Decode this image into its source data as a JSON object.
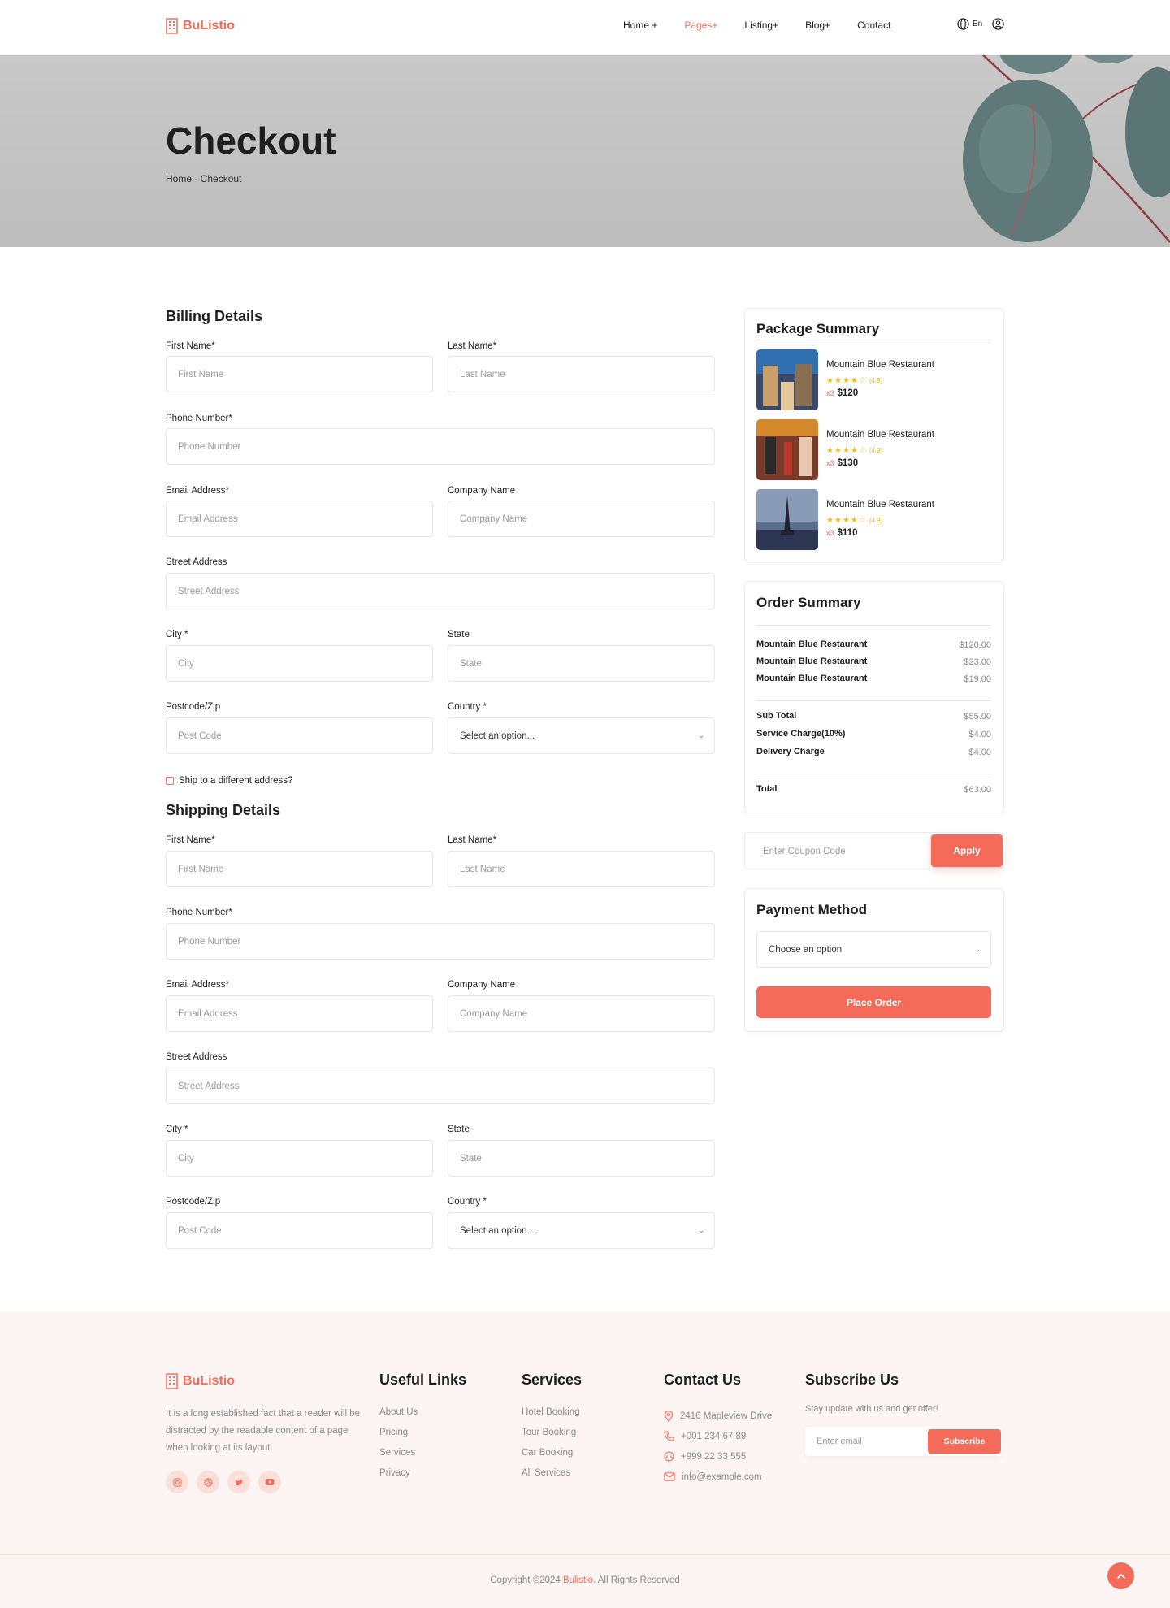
{
  "nav": {
    "brand": "BuListio",
    "links": [
      "Home +",
      "Pages+",
      "Listing+",
      "Blog+",
      "Contact"
    ],
    "active_index": 1,
    "language": "En"
  },
  "hero": {
    "title": "Checkout",
    "breadcrumb": "Home - Checkout"
  },
  "billing": {
    "title": "Billing Details",
    "first_name_label": "First Name*",
    "first_name_placeholder": "First Name",
    "last_name_label": "Last Name*",
    "last_name_placeholder": "Last Name",
    "phone_label": "Phone Number*",
    "phone_placeholder": "Phone Number",
    "email_label": "Email Address*",
    "email_placeholder": "Email Address",
    "company_label": "Company Name",
    "company_placeholder": "Company Name",
    "street_label": "Street Address",
    "street_placeholder": "Street Address",
    "city_label": "City *",
    "city_placeholder": "City",
    "state_label": "State",
    "state_placeholder": "State",
    "postcode_label": "Postcode/Zip",
    "postcode_placeholder": "Post Code",
    "country_label": "Country *",
    "country_value": "Select an option..."
  },
  "ship_checkbox_label": "Ship to a different address?",
  "shipping": {
    "title": "Shipping Details",
    "first_name_label": "First Name*",
    "first_name_placeholder": "First Name",
    "last_name_label": "Last Name*",
    "last_name_placeholder": "Last Name",
    "phone_label": "Phone Number*",
    "phone_placeholder": "Phone Number",
    "email_label": "Email Address*",
    "email_placeholder": "Email Address",
    "company_label": "Company Name",
    "company_placeholder": "Company Name",
    "street_label": "Street Address",
    "street_placeholder": "Street Address",
    "city_label": "City *",
    "city_placeholder": "City",
    "state_label": "State",
    "state_placeholder": "State",
    "postcode_label": "Postcode/Zip",
    "postcode_placeholder": "Post Code",
    "country_label": "Country *",
    "country_value": "Select an option..."
  },
  "package_summary": {
    "title": "Package Summary",
    "items": [
      {
        "name": "Mountain Blue Restaurant",
        "stars": 4,
        "rating": "(4.9)",
        "qty": "x3",
        "price": "$120"
      },
      {
        "name": "Mountain Blue Restaurant",
        "stars": 4,
        "rating": "(4.9)",
        "qty": "x3",
        "price": "$130"
      },
      {
        "name": "Mountain Blue Restaurant",
        "stars": 4,
        "rating": "(4.9)",
        "qty": "x3",
        "price": "$110"
      }
    ]
  },
  "order_summary": {
    "title": "Order Summary",
    "items": [
      {
        "name": "Mountain Blue Restaurant",
        "price": "$120.00"
      },
      {
        "name": "Mountain Blue Restaurant",
        "price": "$23.00"
      },
      {
        "name": "Mountain Blue Restaurant",
        "price": "$19.00"
      }
    ],
    "sub_total_label": "Sub Total",
    "sub_total": "$55.00",
    "service_label": "Service Charge(10%)",
    "service": "$4.00",
    "delivery_label": "Delivery Charge",
    "delivery": "$4.00",
    "total_label": "Total",
    "total": "$63.00"
  },
  "coupon": {
    "placeholder": "Enter Coupon Code",
    "button": "Apply"
  },
  "payment": {
    "title": "Payment Method",
    "select_value": "Choose an option",
    "button": "Place Order"
  },
  "footer": {
    "brand": "BuListio",
    "about": "It is a long established fact that a reader will be distracted by the readable content of a page when looking at its layout.",
    "useful_title": "Useful Links",
    "useful_links": [
      "About Us",
      "Pricing",
      "Services",
      "Privacy"
    ],
    "services_title": "Services",
    "services_links": [
      "Hotel Booking",
      "Tour Booking",
      "Car Booking",
      "All Services"
    ],
    "contact_title": "Contact Us",
    "contact": {
      "address": "2416 Mapleview Drive",
      "phone1": "+001 234 67 89",
      "phone2": "+999 22 33 555",
      "email": "info@example.com"
    },
    "subscribe_title": "Subscribe Us",
    "subscribe_text": "Stay update with us and get offer!",
    "subscribe_placeholder": "Enter email",
    "subscribe_button": "Subscribe",
    "copyright_prefix": "Copyright ©2024 ",
    "copyright_brand": "Bulistio",
    "copyright_suffix": ". All Rights Reserved"
  },
  "colors": {
    "accent": "#f46b59",
    "star": "#f6b818",
    "footer_bg": "#fdf5f3"
  }
}
